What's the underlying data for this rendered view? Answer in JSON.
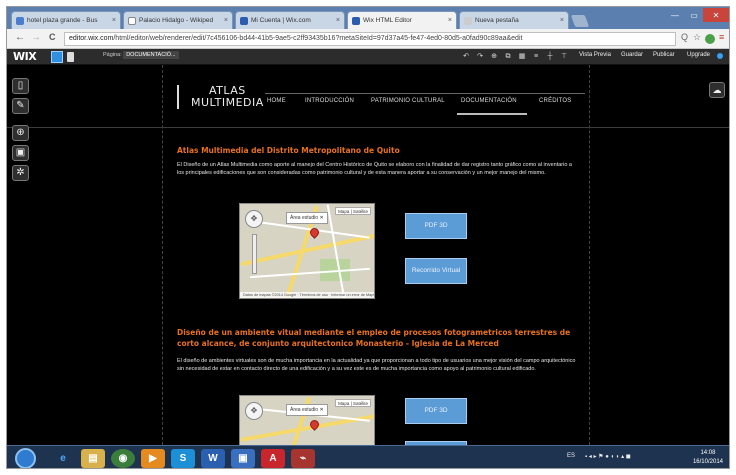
{
  "browser": {
    "tabs": [
      {
        "label": "hotel plaza grande - Bus",
        "color": "#4a7cd0"
      },
      {
        "label": "Palacio Hidalgo - Wikiped",
        "color": "#888888"
      },
      {
        "label": "Mi Cuenta | Wix.com",
        "color": "#2a5db0"
      },
      {
        "label": "Wix HTML Editor",
        "color": "#2a5db0"
      },
      {
        "label": "Nueva pestaña",
        "color": "#cccccc"
      }
    ],
    "close_glyph": "×",
    "url_prefix": "editor.wix.com",
    "url_rest": "/html/editor/web/renderer/edit/7c456106-bd44-41b5-9ae5-c2ff93435b16?metaSiteId=97d37a45-fe47-4ed0-80d5-a0fad90c89aa&edit",
    "back_glyph": "←",
    "forward_glyph": "→",
    "reload_glyph": "C",
    "search_glyph": "Q",
    "star_glyph": "☆",
    "menu_glyph": "≡"
  },
  "wix_bar": {
    "logo": "WIX",
    "page_label": "Página:",
    "page_value": "DOCUMENTACIÓ...",
    "actions": {
      "preview": "Vista Previa",
      "save": "Guardar",
      "publish": "Publicar",
      "upgrade": "Upgrade"
    }
  },
  "site": {
    "logo_line1": "ATLAS",
    "logo_line2": "MULTIMEDIA",
    "menu": [
      "HOME",
      "INTRODUCCIÓN",
      "PATRIMONIO CULTURAL",
      "DOCUMENTACIÓN",
      "CRÉDITOS"
    ],
    "section1": {
      "heading": "Atlas Multimedia del Distrito Metropolitano de Quito",
      "body": "El Diseño de un Atlas Multimedia como aporte al manejo del Centro Histórico de Quito se elaboro con la finalidad de dar registro tanto gráfico como al inventario a los principales edificaciones que son consideradas como patrimonio cultural y de esta manera aportar a su conservación y un mejor manejo del mismo.",
      "map_callout": "Área estudio",
      "map_type": "Mapa | Satélite",
      "map_footer": "Datos de mapas ©2014 Google · Términos de uso · Informar un error de Maps",
      "buttons": [
        "PDF 3D",
        "Recorrido Virtual"
      ]
    },
    "section2": {
      "heading": "Diseño de un ambiente vitual mediante el empleo de procesos fotogrametricos terrestres de corto alcance, de conjunto arquitectonico Monasterio - Iglesia de La Merced",
      "body": "El diseño de ambientes virtuales son de mucha importancia en la actualidad ya que proporcionan a todo tipo de usuarios una mejor visión del campo arquitectónico sin necesidad de estar en contacto directo de una edificación y a su vez este es de mucha importancia como apoyo al patrimonio cultural edificado.",
      "map_callout": "Área estudio",
      "map_type": "Mapa | Satélite",
      "buttons": [
        "PDF 3D"
      ]
    }
  },
  "taskbar": {
    "clock_time": "14:08",
    "clock_date": "16/10/2014",
    "tray_lang": "ES"
  },
  "colors": {
    "heading_orange": "#e8711c",
    "button_blue": "#5b9bd6",
    "taskbar": "#1e3350"
  }
}
